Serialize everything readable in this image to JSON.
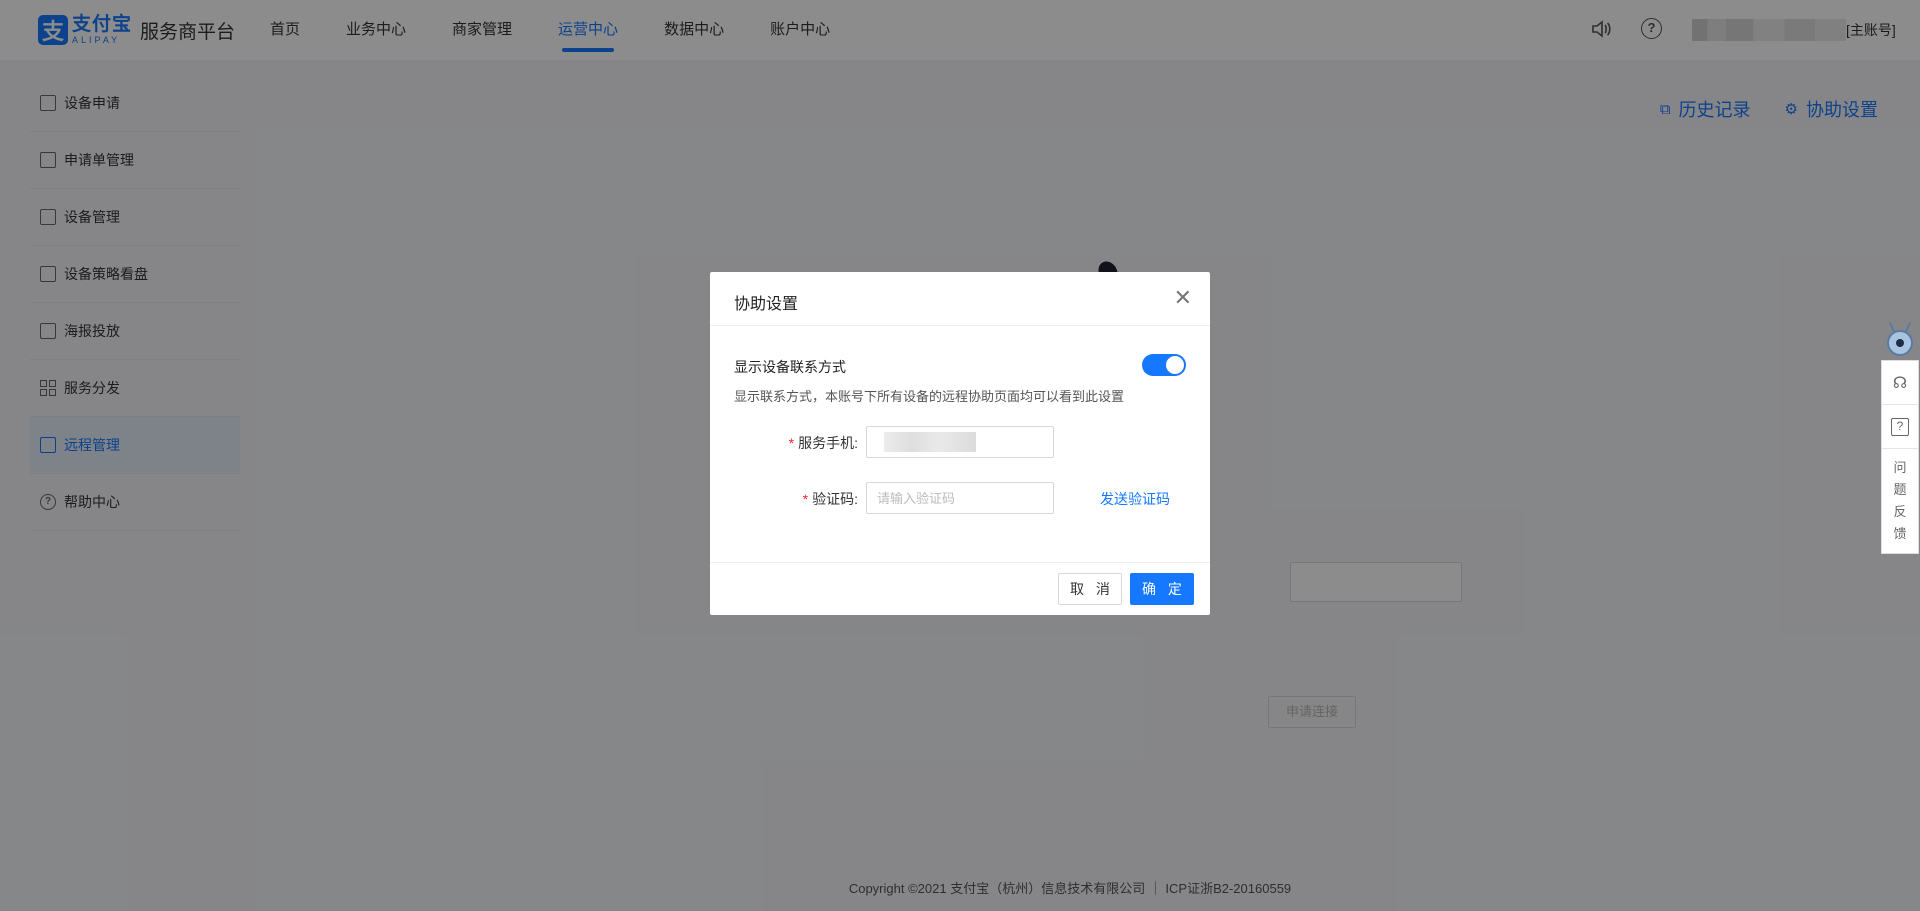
{
  "header": {
    "logo_cn": "支付宝",
    "logo_en": "ALIPAY",
    "platform_title": "服务商平台",
    "nav": [
      {
        "label": "首页",
        "active": false
      },
      {
        "label": "业务中心",
        "active": false
      },
      {
        "label": "商家管理",
        "active": false
      },
      {
        "label": "运营中心",
        "active": true
      },
      {
        "label": "数据中心",
        "active": false
      },
      {
        "label": "账户中心",
        "active": false
      }
    ],
    "account_tag": "[主账号]",
    "icons": [
      "speaker-icon",
      "help-circle-icon"
    ]
  },
  "sidebar": {
    "items": [
      {
        "label": "设备申请",
        "icon": "edit-icon"
      },
      {
        "label": "申请单管理",
        "icon": "user-doc-icon"
      },
      {
        "label": "设备管理",
        "icon": "device-doc-icon"
      },
      {
        "label": "设备策略看盘",
        "icon": "chart-icon"
      },
      {
        "label": "海报投放",
        "icon": "poster-icon"
      },
      {
        "label": "服务分发",
        "icon": "grid-icon"
      },
      {
        "label": "远程管理",
        "icon": "monitor-icon",
        "active": true
      },
      {
        "label": "帮助中心",
        "icon": "help-icon"
      }
    ]
  },
  "main": {
    "history_label": "历史记录",
    "assist_settings_label": "协助设置",
    "apply_connect_label": "申请连接",
    "footer": "Copyright ©2021 支付宝（杭州）信息技术有限公司 ｜ ICP证浙B2-20160559"
  },
  "floating": {
    "feedback_label": "问\n题\n反\n馈"
  },
  "modal": {
    "title": "协助设置",
    "toggle_label": "显示设备联系方式",
    "toggle_on": true,
    "description": "显示联系方式，本账号下所有设备的远程协助页面均可以看到此设置",
    "phone_label": "服务手机:",
    "code_label": "验证码:",
    "code_placeholder": "请输入验证码",
    "send_code": "发送验证码",
    "cancel": "取 消",
    "confirm": "确 定"
  },
  "colors": {
    "accent": "#1677ff",
    "required": "#f5222d"
  }
}
